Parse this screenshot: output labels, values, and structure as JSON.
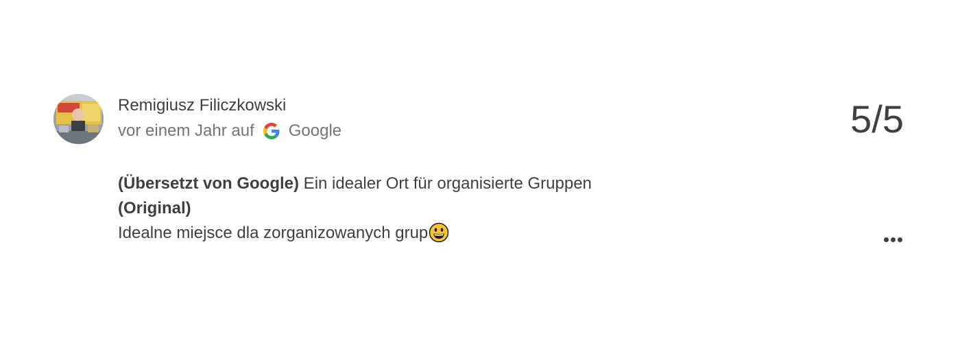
{
  "review": {
    "author_name": "Remigiusz Filiczkowski",
    "time_ago": "vor einem Jahr auf",
    "source_name": "Google",
    "source_icon": "google-g-icon",
    "rating_text": "5/5",
    "translated_label": "(Übersetzt von Google)",
    "translated_text": " Ein idealer Ort für organisierte Gruppen",
    "original_label": "(Original)",
    "original_text": "Idealne miejsce dla zorganizowanych grup",
    "original_emoji": "😀",
    "more_icon": "more-horiz-icon"
  },
  "colors": {
    "text_primary": "#3c4043",
    "text_secondary": "#70757a",
    "background": "#ffffff"
  }
}
